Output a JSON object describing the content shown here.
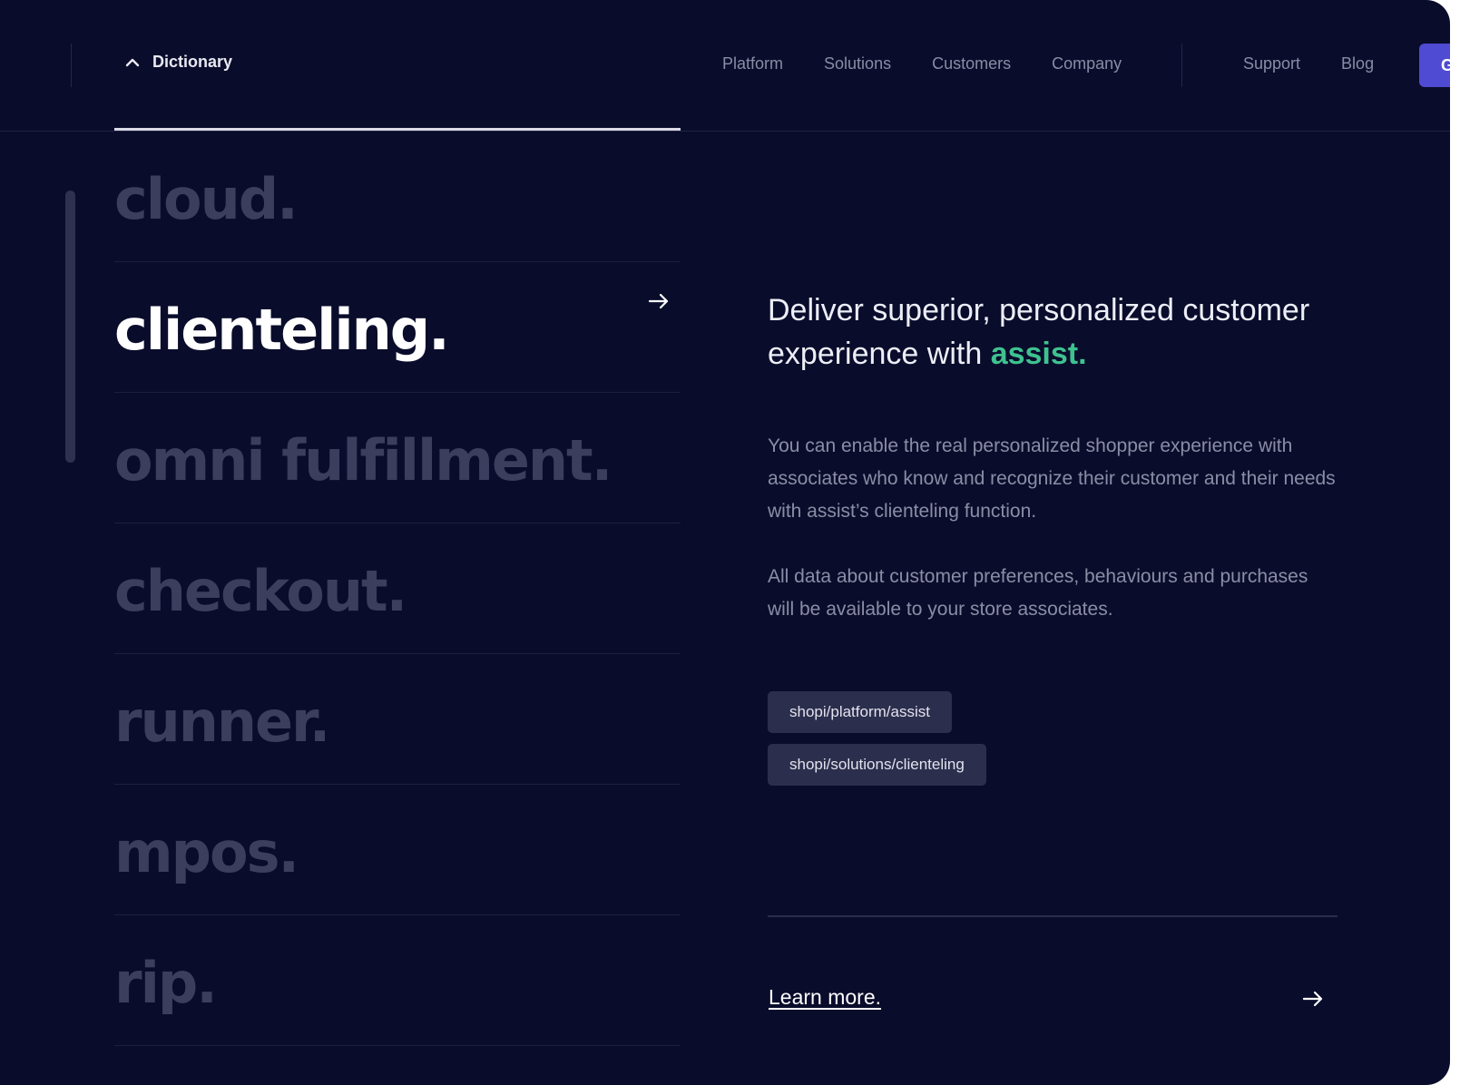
{
  "header": {
    "dictionary_label": "Dictionary",
    "nav_main": [
      "Platform",
      "Solutions",
      "Customers",
      "Company"
    ],
    "nav_secondary": [
      "Support",
      "Blog"
    ],
    "cta_label": "G"
  },
  "terms": [
    "cloud.",
    "clienteling.",
    "omni fulfillment.",
    "checkout.",
    "runner.",
    "mpos.",
    "rip."
  ],
  "active_term_index": 1,
  "detail": {
    "heading_prefix": "Deliver superior, personalized customer experience with ",
    "heading_accent": "assist.",
    "paragraph_1": "You can enable the real personalized shopper experience with associates who know and recognize their customer and their needs with assist’s clienteling function.",
    "paragraph_2": "All data about customer preferences, behaviours and purchases will be available to your store associates.",
    "tags": [
      "shopi/platform/assist",
      "shopi/solutions/clienteling"
    ],
    "learn_more": "Learn more."
  },
  "colors": {
    "background": "#0a0c2b",
    "accent_green": "#3ec28f",
    "cta_purple": "#4f4bd2",
    "inactive_term": "#3c3e5e"
  }
}
